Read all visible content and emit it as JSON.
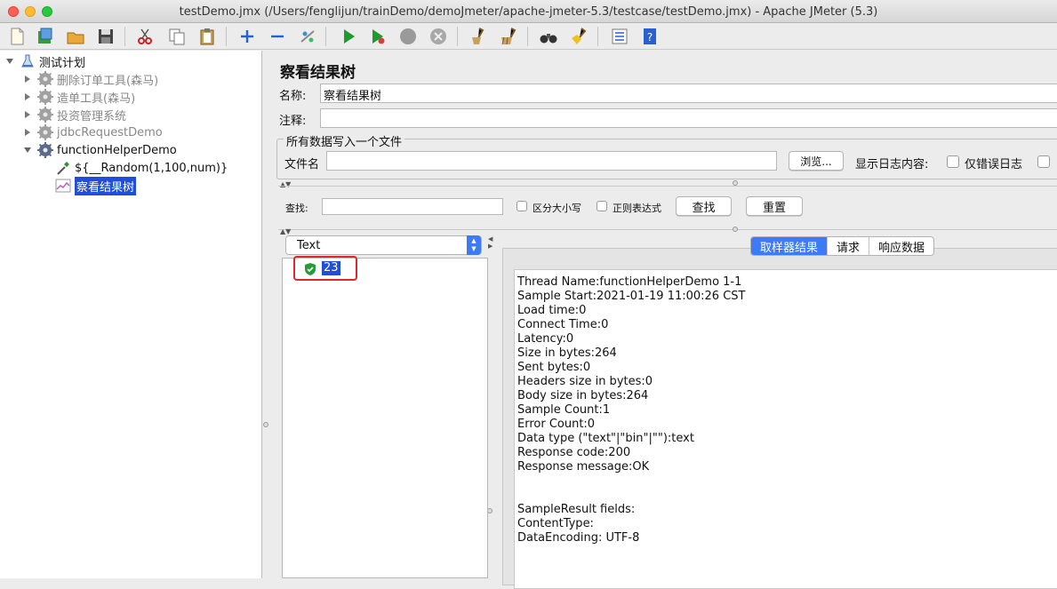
{
  "window": {
    "title": "testDemo.jmx (/Users/fenglijun/trainDemo/demoJmeter/apache-jmeter-5.3/testcase/testDemo.jmx) - Apache JMeter (5.3)"
  },
  "tree": {
    "root": "测试计划",
    "items": [
      {
        "label": "删除订单工具(森马)",
        "disabled": true
      },
      {
        "label": "造单工具(森马)",
        "disabled": true
      },
      {
        "label": "投资管理系统",
        "disabled": true
      },
      {
        "label": "jdbcRequestDemo",
        "disabled": true
      },
      {
        "label": "functionHelperDemo",
        "disabled": false
      }
    ],
    "children": [
      {
        "label": "${__Random(1,100,num)}"
      },
      {
        "label": "察看结果树",
        "selected": true
      }
    ]
  },
  "panel": {
    "heading": "察看结果树",
    "name_label": "名称:",
    "name_value": "察看结果树",
    "comment_label": "注释:",
    "comment_value": "",
    "file_group_title": "所有数据写入一个文件",
    "file_label": "文件名",
    "file_value": "",
    "browse_button": "浏览...",
    "log_label": "显示日志内容:",
    "errors_only_label": "仅错误日志"
  },
  "search": {
    "label": "查找:",
    "value": "",
    "case_label": "区分大小写",
    "regex_label": "正则表达式",
    "find_button": "查找",
    "reset_button": "重置"
  },
  "results": {
    "renderer": "Text",
    "items": [
      {
        "label": "23",
        "status": "success"
      }
    ]
  },
  "tabs": [
    {
      "label": "取样器结果",
      "active": true
    },
    {
      "label": "请求",
      "active": false
    },
    {
      "label": "响应数据",
      "active": false
    }
  ],
  "sampler_result": [
    "Thread Name:functionHelperDemo 1-1",
    "Sample Start:2021-01-19 11:00:26 CST",
    "Load time:0",
    "Connect Time:0",
    "Latency:0",
    "Size in bytes:264",
    "Sent bytes:0",
    "Headers size in bytes:0",
    "Body size in bytes:264",
    "Sample Count:1",
    "Error Count:0",
    "Data type (\"text\"|\"bin\"|\"\"):text",
    "Response code:200",
    "Response message:OK",
    "",
    "",
    "SampleResult fields:",
    "ContentType:",
    "DataEncoding: UTF-8"
  ],
  "colors": {
    "selection": "#1f4fd8",
    "tab_active": "#3d7bf6",
    "highlight_box": "#e0262e",
    "success_icon": "#2a9b3c"
  }
}
